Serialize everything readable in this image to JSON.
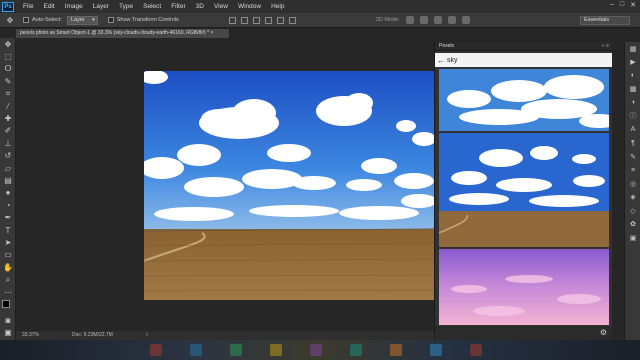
{
  "app": {
    "logo": "Ps"
  },
  "menu": [
    "File",
    "Edit",
    "Image",
    "Layer",
    "Type",
    "Select",
    "Filter",
    "3D",
    "View",
    "Window",
    "Help"
  ],
  "window_controls": [
    "–",
    "□",
    "✕"
  ],
  "options": {
    "auto_select_label": "Auto-Select:",
    "auto_select_value": "Layer",
    "transform_label": "Show Transform Controls",
    "mode_label": "3D Mode:",
    "workspace": "Essentials"
  },
  "document_tab": {
    "title": "pexels photo as Smart Object-1 @ 33.3% (sky-clouds-cloudy-earth-46160, RGB/8#) *",
    "close": "×"
  },
  "status": {
    "zoom": "33.37%",
    "doc_size": "Doc: 9.23M/22.7M",
    "arrow": "›"
  },
  "panel": {
    "title": "Pexels",
    "controls": "›› ≡",
    "search_value": "sky",
    "back_icon": "back-arrow-icon",
    "settings_icon": "gear-icon"
  },
  "left_tools": [
    "move-tool",
    "marquee-tool",
    "lasso-tool",
    "quick-select-tool",
    "crop-tool",
    "eyedropper-tool",
    "healing-tool",
    "brush-tool",
    "stamp-tool",
    "history-brush-tool",
    "eraser-tool",
    "gradient-tool",
    "blur-tool",
    "dodge-tool",
    "pen-tool",
    "type-tool",
    "path-select-tool",
    "shape-tool",
    "hand-tool",
    "zoom-tool",
    "more-tools"
  ],
  "right_icons": [
    "history-icon",
    "actions-icon",
    "color-icon",
    "swatches-icon",
    "adjustments-icon",
    "styles-icon",
    "info-icon",
    "character-icon",
    "paragraph-icon",
    "brush-preset-icon",
    "properties-icon",
    "layers-icon",
    "channels-icon",
    "paths-icon",
    "plugin-icon"
  ],
  "colors": {
    "foreground": "#000000",
    "background": "#ffffff",
    "accent": "#2fa3ff"
  }
}
